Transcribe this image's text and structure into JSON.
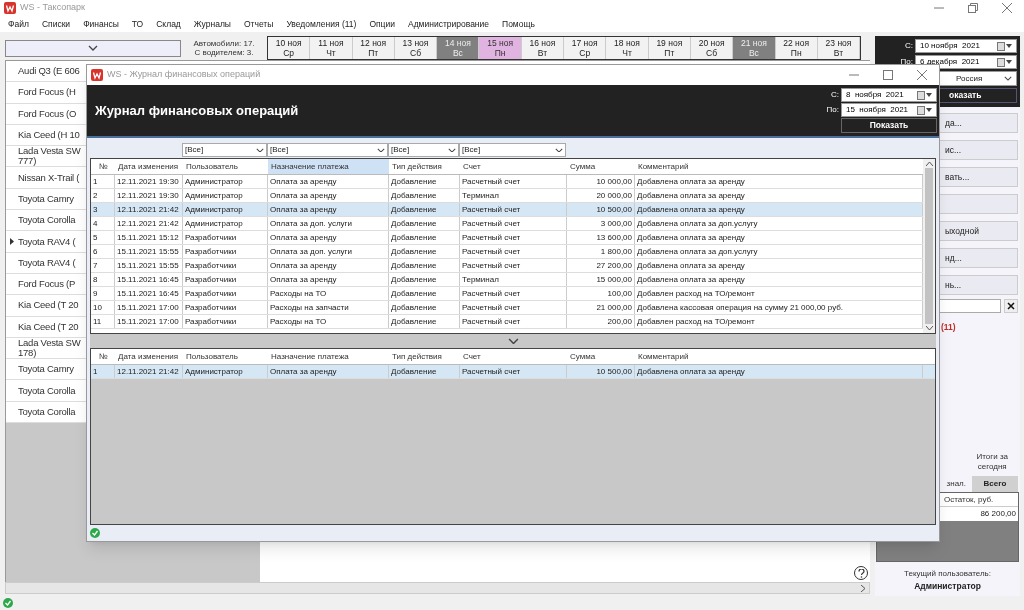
{
  "app": {
    "title": "WS - Таксопарк",
    "menu": [
      "Файл",
      "Списки",
      "Финансы",
      "ТО",
      "Склад",
      "Журналы",
      "Отчеты",
      "Уведомления (11)",
      "Опции",
      "Администрирование",
      "Помощь"
    ]
  },
  "summary_lines": [
    "Автомобили: 17.",
    "С водителем: 3."
  ],
  "days": [
    {
      "date": "10 ноя",
      "weekday": "Ср",
      "kind": "normal"
    },
    {
      "date": "11 ноя",
      "weekday": "Чт",
      "kind": "normal"
    },
    {
      "date": "12 ноя",
      "weekday": "Пт",
      "kind": "normal"
    },
    {
      "date": "13 ноя",
      "weekday": "Сб",
      "kind": "normal"
    },
    {
      "date": "14 ноя",
      "weekday": "Вс",
      "kind": "weekend"
    },
    {
      "date": "15 ноя",
      "weekday": "Пн",
      "kind": "today"
    },
    {
      "date": "16 ноя",
      "weekday": "Вт",
      "kind": "normal"
    },
    {
      "date": "17 ноя",
      "weekday": "Ср",
      "kind": "normal"
    },
    {
      "date": "18 ноя",
      "weekday": "Чт",
      "kind": "normal"
    },
    {
      "date": "19 ноя",
      "weekday": "Пт",
      "kind": "normal"
    },
    {
      "date": "20 ноя",
      "weekday": "Сб",
      "kind": "normal"
    },
    {
      "date": "21 ноя",
      "weekday": "Вс",
      "kind": "weekend"
    },
    {
      "date": "22 ноя",
      "weekday": "Пн",
      "kind": "normal"
    },
    {
      "date": "23 ноя",
      "weekday": "Вт",
      "kind": "normal"
    }
  ],
  "cars": [
    {
      "name": "Audi Q3 (E 606",
      "selected": false
    },
    {
      "name": "Ford Focus (H",
      "selected": false
    },
    {
      "name": "Ford Focus (O",
      "selected": false
    },
    {
      "name": "Kia Ceed (H 10",
      "selected": false
    },
    {
      "name": "Lada Vesta SW\n777)",
      "selected": false
    },
    {
      "name": "Nissan X-Trail (",
      "selected": false
    },
    {
      "name": "Toyota Camry",
      "selected": false
    },
    {
      "name": "Toyota Corolla",
      "selected": false
    },
    {
      "name": "Toyota RAV4 (",
      "selected": true
    },
    {
      "name": "Toyota RAV4 (",
      "selected": false
    },
    {
      "name": "Ford Focus (P",
      "selected": false
    },
    {
      "name": "Kia Ceed (T 20",
      "selected": false
    },
    {
      "name": "Kia Ceed (T 20",
      "selected": false
    },
    {
      "name": "Lada Vesta SW\n178)",
      "selected": false
    },
    {
      "name": "Toyota Camry",
      "selected": false
    },
    {
      "name": "Toyota Corolla",
      "selected": false
    },
    {
      "name": "Toyota Corolla",
      "selected": false
    }
  ],
  "period": {
    "from_label": "С:",
    "from": "10 ноября  2021",
    "to_label": "По:",
    "to": "6 декабря  2021",
    "region": "Россия",
    "show_button": "оказать"
  },
  "side_buttons": [
    {
      "kind": "button",
      "label": "да..."
    },
    {
      "kind": "button",
      "label": "ис..."
    },
    {
      "kind": "button",
      "label": "вать..."
    },
    {
      "kind": "blank"
    },
    {
      "kind": "button",
      "label": "ыходной"
    },
    {
      "kind": "button",
      "label": "нд..."
    },
    {
      "kind": "button",
      "label": "нь..."
    }
  ],
  "notifications_count": "(11)",
  "totals": {
    "caption": "Итоги за\nсегодня",
    "tabs": [
      {
        "label": "знал.",
        "selected": false
      },
      {
        "label": "Всего",
        "selected": true
      }
    ],
    "column": "Остаток, руб.",
    "value": "86 200,00"
  },
  "current_user": {
    "label": "Текущий пользователь:",
    "name": "Администратор"
  },
  "dialog": {
    "title": "WS - Журнал финансовых операций",
    "heading": "Журнал финансовых операций",
    "period": {
      "from_label": "С:",
      "from": "8  ноября  2021",
      "to_label": "По:",
      "to": "15  ноября  2021",
      "button": "Показать"
    },
    "filters": [
      "[Все]",
      "[Все]",
      "[Все]",
      "[Все]"
    ],
    "columns": [
      {
        "label": "№",
        "selected": false
      },
      {
        "label": "Дата изменения",
        "selected": false
      },
      {
        "label": "Пользователь",
        "selected": false
      },
      {
        "label": "Назначение платежа",
        "selected": true
      },
      {
        "label": "Тип действия",
        "selected": false
      },
      {
        "label": "Счет",
        "selected": false
      },
      {
        "label": "Сумма",
        "selected": false
      },
      {
        "label": "Комментарий",
        "selected": false
      }
    ],
    "rows": [
      {
        "selected": false,
        "cells": [
          "1",
          "12.11.2021 19:30",
          "Администратор",
          "Оплата за аренду",
          "Добавление",
          "Расчетный счет",
          "10 000,00",
          "Добавлена оплата за аренду"
        ]
      },
      {
        "selected": false,
        "cells": [
          "2",
          "12.11.2021 19:30",
          "Администратор",
          "Оплата за аренду",
          "Добавление",
          "Терминал",
          "20 000,00",
          "Добавлена оплата за аренду"
        ]
      },
      {
        "selected": true,
        "cells": [
          "3",
          "12.11.2021 21:42",
          "Администратор",
          "Оплата за аренду",
          "Добавление",
          "Расчетный счет",
          "10 500,00",
          "Добавлена оплата за аренду"
        ]
      },
      {
        "selected": false,
        "cells": [
          "4",
          "12.11.2021 21:42",
          "Администратор",
          "Оплата за доп. услуги",
          "Добавление",
          "Расчетный счет",
          "3 000,00",
          "Добавлена оплата за доп.услугу"
        ]
      },
      {
        "selected": false,
        "cells": [
          "5",
          "15.11.2021 15:12",
          "Разработчики",
          "Оплата за аренду",
          "Добавление",
          "Расчетный счет",
          "13 600,00",
          "Добавлена оплата за аренду"
        ]
      },
      {
        "selected": false,
        "cells": [
          "6",
          "15.11.2021 15:55",
          "Разработчики",
          "Оплата за доп. услуги",
          "Добавление",
          "Расчетный счет",
          "1 800,00",
          "Добавлена оплата за доп.услугу"
        ]
      },
      {
        "selected": false,
        "cells": [
          "7",
          "15.11.2021 15:55",
          "Разработчики",
          "Оплата за аренду",
          "Добавление",
          "Расчетный счет",
          "27 200,00",
          "Добавлена оплата за аренду"
        ]
      },
      {
        "selected": false,
        "cells": [
          "8",
          "15.11.2021 16:45",
          "Разработчики",
          "Оплата за аренду",
          "Добавление",
          "Терминал",
          "15 000,00",
          "Добавлена оплата за аренду"
        ]
      },
      {
        "selected": false,
        "cells": [
          "9",
          "15.11.2021 16:45",
          "Разработчики",
          "Расходы на ТО",
          "Добавление",
          "Расчетный счет",
          "100,00",
          "Добавлен расход на ТО/ремонт"
        ]
      },
      {
        "selected": false,
        "cells": [
          "10",
          "15.11.2021 17:00",
          "Разработчики",
          "Расходы на запчасти",
          "Добавление",
          "Расчетный счет",
          "21 000,00",
          "Добавлена кассовая операция на сумму 21 000,00 руб."
        ]
      },
      {
        "selected": false,
        "cells": [
          "11",
          "15.11.2021 17:00",
          "Разработчики",
          "Расходы на ТО",
          "Добавление",
          "Расчетный счет",
          "200,00",
          "Добавлен расход на ТО/ремонт"
        ]
      }
    ],
    "detail": {
      "columns": [
        "№",
        "Дата изменения",
        "Пользователь",
        "Назначение платежа",
        "Тип действия",
        "Счет",
        "Сумма",
        "Комментарий"
      ],
      "rows": [
        {
          "selected": true,
          "cells": [
            "1",
            "12.11.2021 21:42",
            "Администратор",
            "Оплата за аренду",
            "Добавление",
            "Расчетный счет",
            "10 500,00",
            "Добавлена оплата за аренду"
          ]
        }
      ]
    }
  }
}
